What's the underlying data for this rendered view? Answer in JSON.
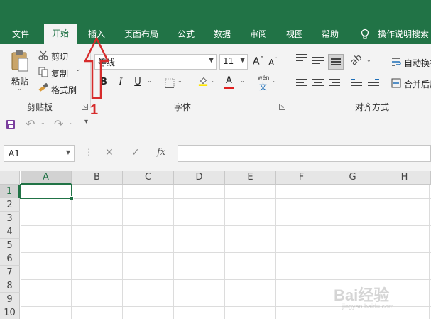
{
  "tabs": {
    "file": "文件",
    "home": "开始",
    "insert": "插入",
    "page_layout": "页面布局",
    "formulas": "公式",
    "data": "数据",
    "review": "审阅",
    "view": "视图",
    "help": "帮助",
    "tell_me": "操作说明搜索"
  },
  "clipboard": {
    "paste": "粘贴",
    "cut": "剪切",
    "copy": "复制",
    "format_painter": "格式刷",
    "group_label": "剪贴板"
  },
  "font": {
    "font_name": "等线",
    "font_size": "11",
    "bold": "B",
    "italic": "I",
    "underline": "U",
    "phonetic": "wén",
    "group_label": "字体"
  },
  "alignment": {
    "wrap_text": "自动换行",
    "merge_center": "合并后居中",
    "group_label": "对齐方式"
  },
  "formula_bar": {
    "name_box": "A1",
    "fx": "fx",
    "formula": ""
  },
  "columns": [
    "A",
    "B",
    "C",
    "D",
    "E",
    "F",
    "G",
    "H"
  ],
  "rows": [
    "1",
    "2",
    "3",
    "4",
    "5",
    "6",
    "7",
    "8",
    "9",
    "10"
  ],
  "annotation": {
    "number": "1"
  },
  "watermark": {
    "brand": "Bai经验",
    "url": "jingyan.baidu.com"
  },
  "colors": {
    "accent": "#217346",
    "annotation": "#d62b2b"
  }
}
